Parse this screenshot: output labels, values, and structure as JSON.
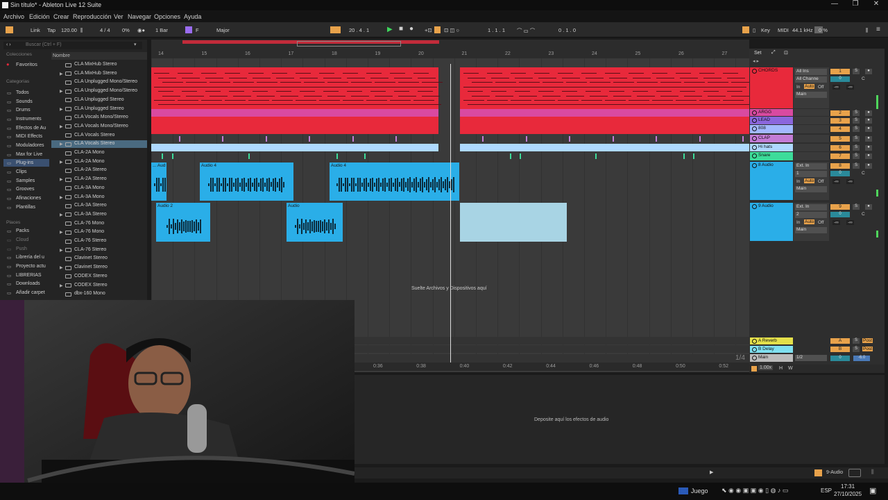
{
  "window": {
    "title": "Sin título* - Ableton Live 12 Suite"
  },
  "menu": [
    "Archivo",
    "Edición",
    "Crear",
    "Reproducción",
    "Ver",
    "Navegar",
    "Opciones",
    "Ayuda"
  ],
  "control": {
    "link": "Link",
    "tap": "Tap",
    "tempo": "120.00",
    "signature": "4 / 4",
    "metronome_pct": "0%",
    "quant": "1 Bar",
    "key": "F",
    "scale": "Major",
    "position": "20 .  4 .  1",
    "loop_start": "1 .  1 .  1",
    "loop_len": "0 .  1 .  0",
    "key_label": "Key",
    "midi_label": "MIDI",
    "sample_rate": "44.1 kHz",
    "cpu": "0 %"
  },
  "browser": {
    "search_placeholder": "Buscar (Ctrl + F)",
    "col_header": "Nombre",
    "collections_header": "Colecciones",
    "favorites": "Favoritos",
    "categories_header": "Categorías",
    "categories": [
      "Todos",
      "Sounds",
      "Drums",
      "Instruments",
      "Efectos de Au",
      "MIDI Effects",
      "Moduladores",
      "Max for Live",
      "Plug-ins",
      "Clips",
      "Samples",
      "Grooves",
      "Afinaciones",
      "Plantillas"
    ],
    "places_header": "Places",
    "places": [
      "Packs",
      "Cloud",
      "Push",
      "Librería del u",
      "Proyecto actu",
      "LIBRERIAS",
      "Downloads",
      "Añadir carpet"
    ],
    "files": [
      "CLA MixHub Stereo",
      "CLA MixHub Stereo",
      "CLA Unplugged Mono/Stereo",
      "CLA Unplugged Mono/Stereo",
      "CLA Unplugged Stereo",
      "CLA Unplugged Stereo",
      "CLA Vocals Mono/Stereo",
      "CLA Vocals Mono/Stereo",
      "CLA Vocals Stereo",
      "CLA Vocals Stereo",
      "CLA-2A Mono",
      "CLA-2A Mono",
      "CLA-2A Stereo",
      "CLA-2A Stereo",
      "CLA-3A Mono",
      "CLA-3A Mono",
      "CLA-3A Stereo",
      "CLA-3A Stereo",
      "CLA-76 Mono",
      "CLA-76 Mono",
      "CLA-76 Stereo",
      "CLA-76 Stereo",
      "Clavinet Stereo",
      "Clavinet Stereo",
      "CODEX Stereo",
      "CODEX Stereo",
      "dbx-160 Mono"
    ]
  },
  "ruler": [
    "14",
    "15",
    "16",
    "17",
    "18",
    "19",
    "20",
    "21",
    "22",
    "23",
    "24",
    "25",
    "26",
    "27"
  ],
  "time_ruler": [
    "0:36",
    "0:38",
    "0:40",
    "0:42",
    "0:44",
    "0:46",
    "0:48",
    "0:50",
    "0:52"
  ],
  "arrangement": {
    "drop_hint": "Suelte Archivos y Dispositivos aquí",
    "set_label": "Set",
    "zoom_fraction": "1/4",
    "bpm_scale": "1.00x",
    "h": "H",
    "w": "W",
    "clips": {
      "audio4a": "Audio 4",
      "audio4b": "Audio 4",
      "audio_left": "... Aud",
      "audio2": "Audio 2",
      "audio": "Audio"
    }
  },
  "tracks": [
    {
      "name": "CHORDS",
      "num": "1",
      "color": "#e8293b",
      "input": "All Ins",
      "channel": "All Channe",
      "monitor_in": "In",
      "monitor_auto": "Auto",
      "monitor_off": "Off",
      "out": "Main",
      "vol": "-∞",
      "pan": "-∞",
      "send_c": "C",
      "send_0": "0"
    },
    {
      "name": "ARGG",
      "num": "2",
      "color": "#d94aa0"
    },
    {
      "name": "LEAD",
      "num": "3",
      "color": "#8c67de"
    },
    {
      "name": "808",
      "num": "4",
      "color": "#a3b9ff"
    },
    {
      "name": "CLAP",
      "num": "5",
      "color": "#c47cd6"
    },
    {
      "name": "Hi hats",
      "num": "6",
      "color": "#aed9ff"
    },
    {
      "name": "Snare",
      "num": "7",
      "color": "#3ddc9a"
    },
    {
      "name": "8 Audio",
      "num": "8",
      "color": "#2aaee8",
      "input": "Ext. In",
      "channel": "1",
      "monitor_in": "In",
      "monitor_auto": "Auto",
      "monitor_off": "Off",
      "out": "Main",
      "vol": "-∞",
      "pan": "-∞",
      "send_c": "C",
      "send_0": "0"
    },
    {
      "name": "9 Audio",
      "num": "9",
      "color": "#2aaee8",
      "input": "Ext. In",
      "channel": "2",
      "monitor_in": "In",
      "monitor_auto": "Auto",
      "monitor_off": "Off",
      "out": "Main",
      "vol": "-∞",
      "pan": "-∞",
      "send_c": "C",
      "send_0": "0"
    }
  ],
  "returns": [
    {
      "name": "A Reverb",
      "letter": "A",
      "post": "Post"
    },
    {
      "name": "B Delay",
      "letter": "B",
      "post": "Post"
    }
  ],
  "master": {
    "name": "Main",
    "out": "1/2",
    "vol": "0",
    "db": "-6.0"
  },
  "device_hint": "Deposite aquí los efectos de audio",
  "status": {
    "track": "9-Audio"
  },
  "taskbar": {
    "app": "Juego",
    "lang": "ESP",
    "time": "17:31",
    "date": "27/10/2025"
  }
}
